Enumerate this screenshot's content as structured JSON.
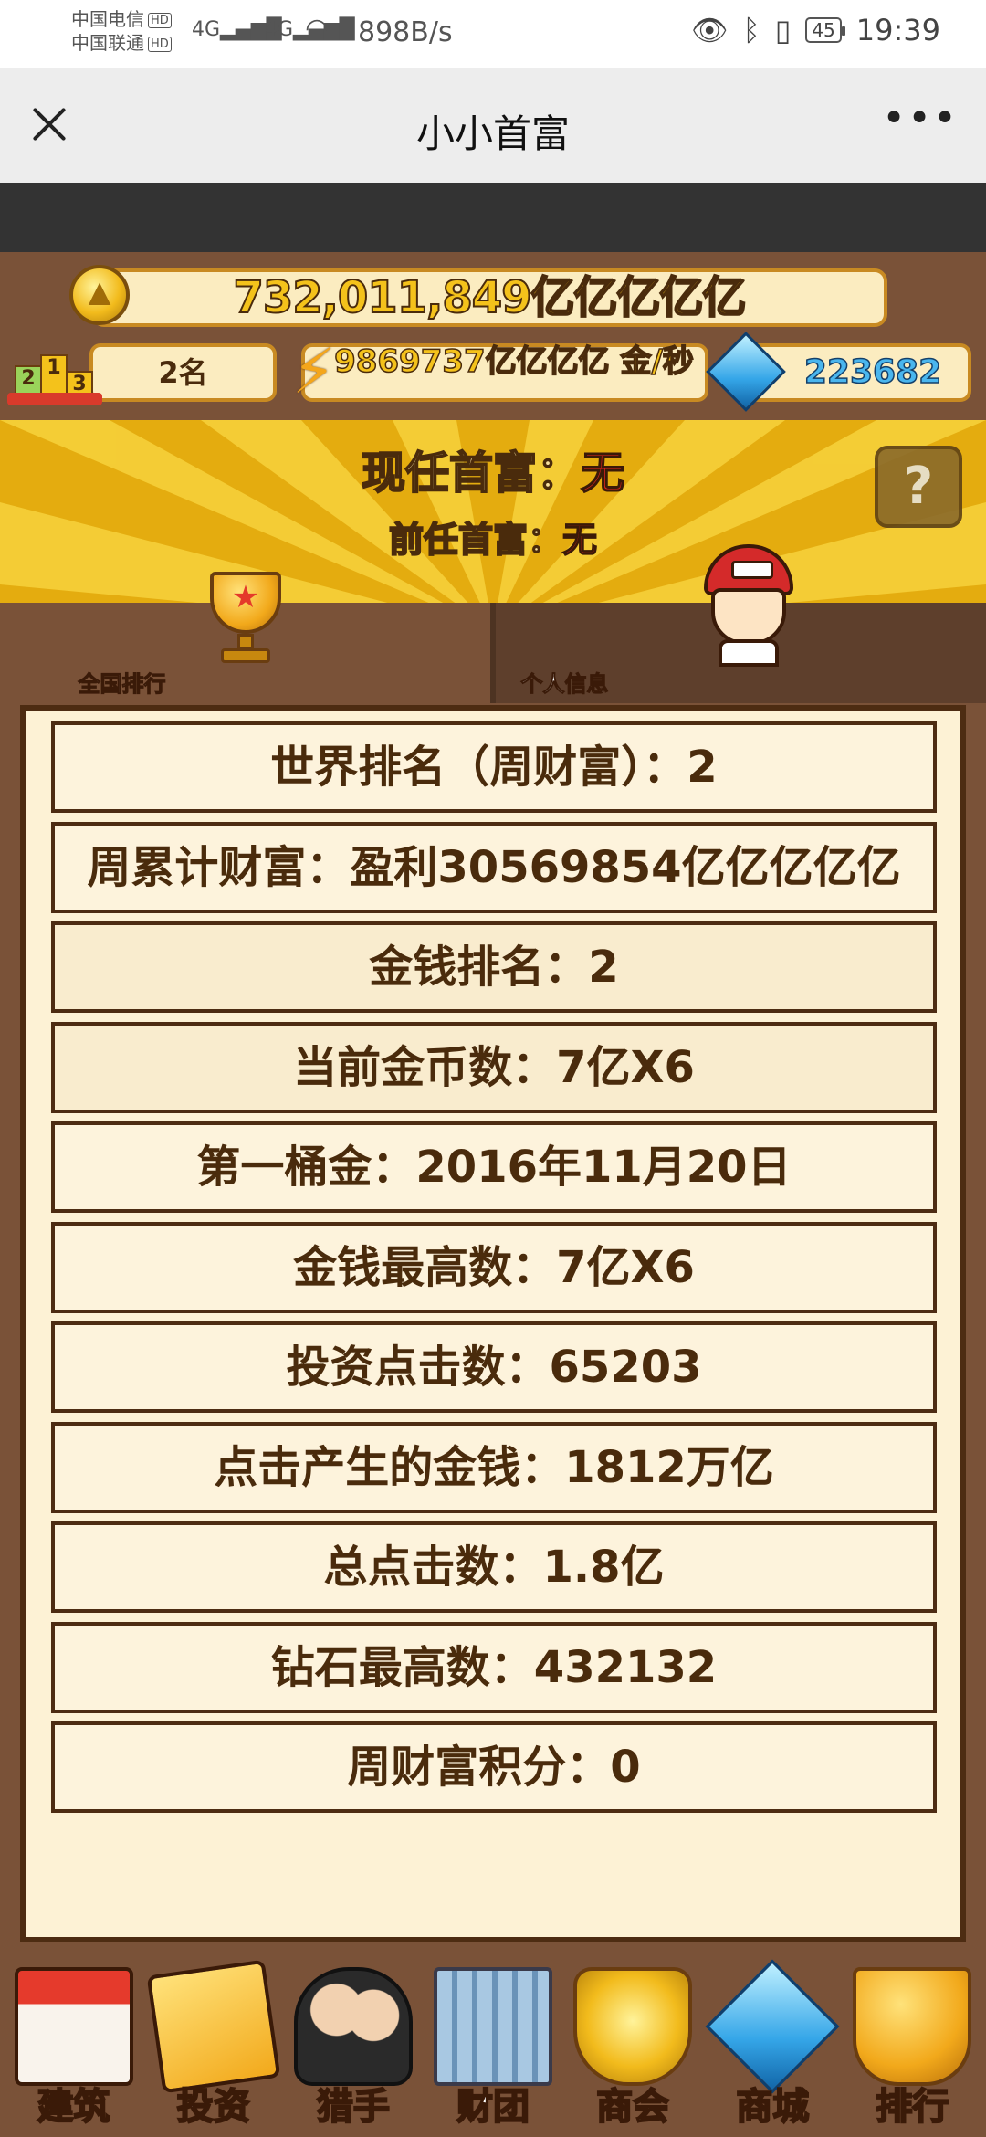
{
  "status_bar": {
    "carrier_1": "中国电信",
    "carrier_2": "中国联通",
    "hd_badge": "HD",
    "signal_1": "4G",
    "signal_2": "4G",
    "net_speed": "898B/s",
    "battery": "45",
    "time": "19:39"
  },
  "title_bar": {
    "title": "小小首富",
    "more": "•••"
  },
  "header": {
    "gold_total": "732,011,849亿亿亿亿亿",
    "rank": "2名",
    "income_per_sec": "9869737亿亿亿亿 金/秒",
    "diamonds": "223682",
    "podium_labels": [
      "2",
      "1",
      "3"
    ]
  },
  "banner": {
    "current_label": "现任首富：",
    "current_value": "无",
    "previous_label": "前任首富：",
    "previous_value": "无",
    "help": "?"
  },
  "tabs": [
    {
      "label": "全国排行",
      "active": false
    },
    {
      "label": "个人信息",
      "active": true
    }
  ],
  "stats": [
    "世界排名（周财富）：2",
    "周累计财富：盈利30569854亿亿亿亿亿",
    "金钱排名：2",
    "当前金币数：7亿X6",
    "第一桶金：2016年11月20日",
    "金钱最高数：7亿X6",
    "投资点击数：65203",
    "点击产生的金钱：1812万亿",
    "总点击数：1.8亿",
    "钻石最高数：432132",
    "周财富积分：0"
  ],
  "bottom_nav": [
    {
      "label": "建筑",
      "icon": "shop-icon"
    },
    {
      "label": "投资",
      "icon": "investment-icon"
    },
    {
      "label": "猎手",
      "icon": "hunter-icon"
    },
    {
      "label": "财团",
      "icon": "office-building-icon"
    },
    {
      "label": "商会",
      "icon": "guild-badge-icon"
    },
    {
      "label": "商城",
      "icon": "diamond-store-icon"
    },
    {
      "label": "排行",
      "icon": "trophy-icon"
    }
  ]
}
